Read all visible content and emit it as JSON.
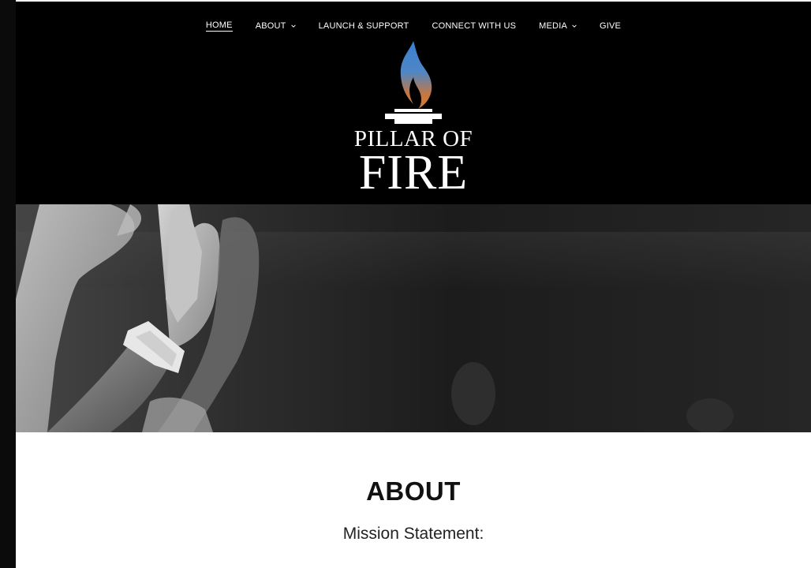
{
  "nav": {
    "items": [
      {
        "label": "HOME",
        "active": true,
        "dropdown": false
      },
      {
        "label": "ABOUT",
        "active": false,
        "dropdown": true
      },
      {
        "label": "LAUNCH & SUPPORT",
        "active": false,
        "dropdown": false
      },
      {
        "label": "CONNECT WITH US",
        "active": false,
        "dropdown": false
      },
      {
        "label": "MEDIA",
        "active": false,
        "dropdown": true
      },
      {
        "label": "GIVE",
        "active": false,
        "dropdown": false
      }
    ]
  },
  "logo": {
    "line1": "PILLAR OF",
    "line2": "FIRE",
    "flame_colors": [
      "#3a7fd0",
      "#d27a3f"
    ]
  },
  "main": {
    "heading": "ABOUT",
    "subheading": "Mission Statement:"
  },
  "colors": {
    "header_bg": "#000000",
    "text_light": "#ffffff",
    "text_dark": "#111111"
  }
}
